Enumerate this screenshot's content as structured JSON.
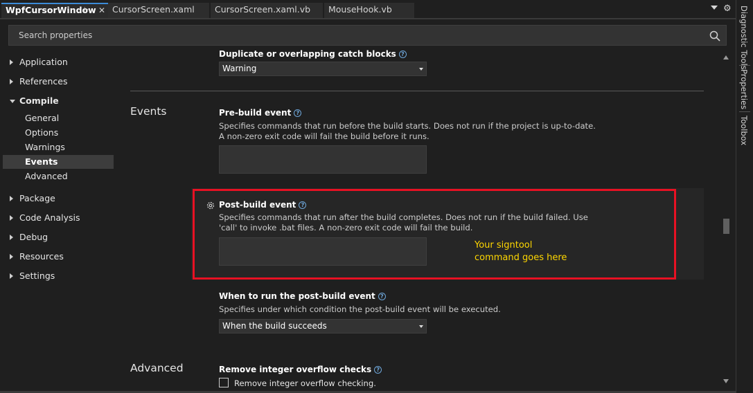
{
  "tabs": [
    {
      "label": "WpfCursorWindow",
      "active": true
    },
    {
      "label": "CursorScreen.xaml",
      "active": false
    },
    {
      "label": "CursorScreen.xaml.vb",
      "active": false
    },
    {
      "label": "MouseHook.vb",
      "active": false
    }
  ],
  "tab_icons": {
    "pin": "pin-icon",
    "close": "close-icon",
    "menu": "chevron-down-icon",
    "settings": "gear-icon"
  },
  "search": {
    "placeholder": "Search properties",
    "icon": "search-icon"
  },
  "nav": [
    {
      "label": "Application",
      "level": 0,
      "expanded": false
    },
    {
      "label": "References",
      "level": 0,
      "expanded": false
    },
    {
      "label": "Compile",
      "level": 0,
      "expanded": true
    },
    {
      "label": "General",
      "level": 1
    },
    {
      "label": "Options",
      "level": 1
    },
    {
      "label": "Warnings",
      "level": 1
    },
    {
      "label": "Events",
      "level": 1,
      "selected": true
    },
    {
      "label": "Advanced",
      "level": 1
    },
    {
      "label": "Package",
      "level": 0,
      "expanded": false
    },
    {
      "label": "Code Analysis",
      "level": 0,
      "expanded": false
    },
    {
      "label": "Debug",
      "level": 0,
      "expanded": false
    },
    {
      "label": "Resources",
      "level": 0,
      "expanded": false
    },
    {
      "label": "Settings",
      "level": 0,
      "expanded": false
    }
  ],
  "main": {
    "dup_catch": {
      "title": "Duplicate or overlapping catch blocks",
      "value": "Warning"
    },
    "events": {
      "section_title": "Events",
      "pre_build": {
        "title": "Pre-build event",
        "desc_line1": "Specifies commands that run before the build starts. Does not run if the project is up-to-date.",
        "desc_line2": "A non-zero exit code will fail the build before it runs.",
        "value": ""
      },
      "post_build": {
        "title": "Post-build event",
        "desc_line1": "Specifies commands that run after the build completes. Does not run if the build failed. Use",
        "desc_line2": "'call' to invoke .bat files. A non-zero exit code will fail the build.",
        "value": "",
        "annotation_line1": "Your signtool",
        "annotation_line2": "command goes here"
      },
      "run_post_build": {
        "title": "When to run the post-build event",
        "desc": "Specifies under which condition the post-build event will be executed.",
        "value": "When the build succeeds"
      }
    },
    "advanced": {
      "section_title": "Advanced",
      "overflow": {
        "title": "Remove integer overflow checks",
        "checkbox_label": "Remove integer overflow checking.",
        "checked": false
      }
    }
  },
  "toolstrip": [
    "Diagnostic Tools",
    "Properties",
    "Toolbox"
  ],
  "colors": {
    "accent": "#3c8cd8",
    "highlight_border": "#e81123",
    "annotation": "#ffd700",
    "background": "#1f1f1f"
  }
}
